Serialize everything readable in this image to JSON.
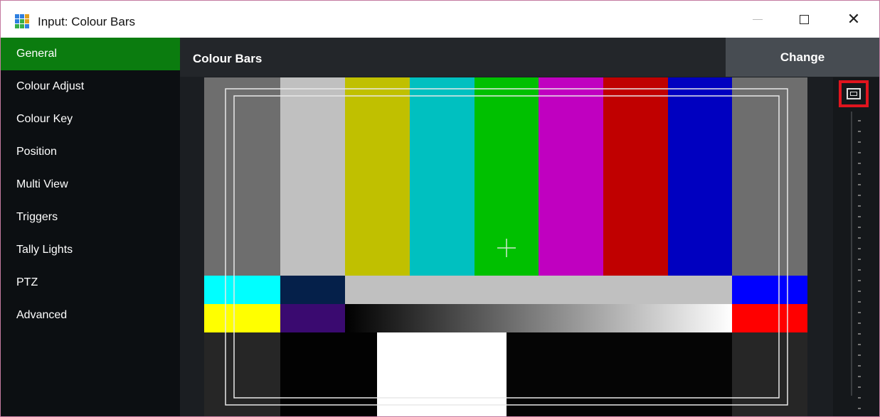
{
  "window": {
    "title": "Input: Colour Bars",
    "close_glyph": "✕"
  },
  "sidebar": {
    "items": [
      {
        "label": "General",
        "active": true
      },
      {
        "label": "Colour Adjust",
        "active": false
      },
      {
        "label": "Colour Key",
        "active": false
      },
      {
        "label": "Position",
        "active": false
      },
      {
        "label": "Multi View",
        "active": false
      },
      {
        "label": "Triggers",
        "active": false
      },
      {
        "label": "Tally Lights",
        "active": false
      },
      {
        "label": "PTZ",
        "active": false
      },
      {
        "label": "Advanced",
        "active": false
      }
    ]
  },
  "main": {
    "input_name": "Colour Bars",
    "change_label": "Change"
  },
  "colors": {
    "active_sidebar": "#0b7c0f",
    "highlight_border": "#e0141e",
    "colour_bars": [
      "#c0c0c0",
      "#c0c000",
      "#00c0c0",
      "#00c000",
      "#c000c0",
      "#c00000",
      "#0000c0"
    ]
  },
  "icons": {
    "app": "vmix-grid-icon",
    "fit": "zoom-fit-icon"
  }
}
